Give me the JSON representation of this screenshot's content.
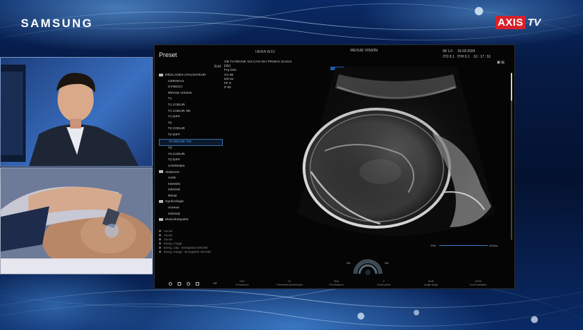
{
  "branding": {
    "samsung": "SAMSUNG",
    "axis_red": "AXIS",
    "axis_tv": "TV",
    "axis_red_color": "#d8202a"
  },
  "ultrasound": {
    "preset_title": "Preset",
    "exit_label": "Exit",
    "model": "HERA W10",
    "mode_title": "REVUE VISION",
    "top_right_line1": "IM 1.0     16-03-2024",
    "top_right_line2": "ITO 0.1   ITIH 0.1    10 : 17 : 51",
    "image_info": [
      "OB   T2 REVUE VIS   CA3-10A   FR34Hz   10.0cm",
      "[2D]",
      "Frq   Gén",
      "Gn    58",
      "DR    51",
      "FF     8",
      "P      90"
    ],
    "menu": [
      {
        "kind": "cat",
        "label": "RÉGLAGES UTILISATEUR"
      },
      {
        "kind": "sub",
        "label": "CERVEAU"
      },
      {
        "kind": "sub",
        "label": "GYNECO"
      },
      {
        "kind": "sub",
        "label": "REVUE VISION"
      },
      {
        "kind": "sub",
        "label": "T1"
      },
      {
        "kind": "sub",
        "label": "T1 COEUR"
      },
      {
        "kind": "sub",
        "label": "T1 COEUR HD"
      },
      {
        "kind": "sub",
        "label": "T1 DIFF"
      },
      {
        "kind": "sub",
        "label": "T2"
      },
      {
        "kind": "sub",
        "label": "T2 COEUR"
      },
      {
        "kind": "sub",
        "label": "T2 DIFF"
      },
      {
        "kind": "sel",
        "label": "T2 REVUE VIS"
      },
      {
        "kind": "sub",
        "label": "T3"
      },
      {
        "kind": "sub",
        "label": "T3 COEUR"
      },
      {
        "kind": "sub",
        "label": "T3 DIFF"
      },
      {
        "kind": "sub",
        "label": "UTERINES"
      },
      {
        "kind": "cat",
        "label": "Abdomen"
      },
      {
        "kind": "sub",
        "label": "Aorte"
      },
      {
        "kind": "sub",
        "label": "Intestins"
      },
      {
        "kind": "sub",
        "label": "Général"
      },
      {
        "kind": "sub",
        "label": "Rénal"
      },
      {
        "kind": "cat",
        "label": "Gynécologie"
      },
      {
        "kind": "sub",
        "label": "Annexe"
      },
      {
        "kind": "sub",
        "label": "Général"
      },
      {
        "kind": "cat",
        "label": "Musculosquelet"
      }
    ],
    "options": [
      "Aucun",
      "Aucun",
      "Aucun",
      "Enreg. Image",
      "Enreg. Clip - Enregistrer DICOM",
      "Enreg. Image - Enregistrer DICOM"
    ],
    "controls": [
      {
        "value": "Gén",
        "label": "Fréquence"
      },
      {
        "value": "11",
        "label": "Contraste/dynamique"
      },
      {
        "value": "Bas",
        "label": "Persistance"
      },
      {
        "value": "0",
        "label": "Carte grise"
      },
      {
        "value": "Arrêt",
        "label": "Angle large"
      },
      {
        "value": "100%",
        "label": "Zone balayée"
      }
    ],
    "gain_left": "70%",
    "gain_right": "870ms",
    "dial_left": "3W",
    "dial_right": "3W",
    "bottom_label": "Off"
  }
}
